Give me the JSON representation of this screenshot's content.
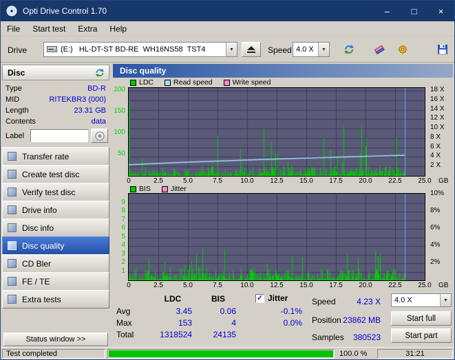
{
  "window": {
    "title": "Opti Drive Control 1.70"
  },
  "titlebar": {
    "minimize_glyph": "–",
    "maximize_glyph": "□",
    "close_glyph": "×"
  },
  "menu": {
    "items": [
      "File",
      "Start test",
      "Extra",
      "Help"
    ]
  },
  "toolbar": {
    "drive_label": "Drive",
    "drive_value": "(E:)   HL-DT-ST BD-RE  WH16NS58  TST4",
    "speed_label": "Speed",
    "speed_value": "4.0 X"
  },
  "sidebar": {
    "disc_header": "Disc",
    "info": [
      {
        "label": "Type",
        "value": "BD-R"
      },
      {
        "label": "MID",
        "value": "RITEKBR3 (000)"
      },
      {
        "label": "Length",
        "value": "23.31 GB"
      },
      {
        "label": "Contents",
        "value": "data"
      }
    ],
    "label_label": "Label",
    "label_value": "",
    "buttons": [
      "Transfer rate",
      "Create test disc",
      "Verify test disc",
      "Drive info",
      "Disc info",
      "Disc quality",
      "CD Bler",
      "FE / TE",
      "Extra tests"
    ],
    "selected": "Disc quality",
    "status_window": "Status window >>"
  },
  "panel": {
    "title": "Disc quality"
  },
  "chart_data": [
    {
      "type": "bar",
      "title": "Disc quality - LDC / Read speed",
      "plot_bg": "#5a5a78",
      "grid_color": "#3a3a58",
      "legend": [
        {
          "label": "LDC",
          "color": "#00c800"
        },
        {
          "label": "Read speed",
          "color": "#a8dcff"
        },
        {
          "label": "Write speed",
          "color": "#f48cc8"
        }
      ],
      "x_axis": {
        "range": [
          0,
          25
        ],
        "ticks": [
          "0",
          "2.5",
          "5.0",
          "7.5",
          "10.0",
          "12.5",
          "15.0",
          "17.5",
          "20.0",
          "22.5",
          "25.0"
        ],
        "unit": "GB"
      },
      "left_axis": {
        "range": [
          0,
          207
        ],
        "color": "#00d400",
        "ticks": [
          {
            "v": 200,
            "label": "200"
          },
          {
            "v": 150,
            "label": "150"
          },
          {
            "v": 100,
            "label": "100"
          },
          {
            "v": 50,
            "label": "50"
          }
        ]
      },
      "right_axis": {
        "range": [
          0,
          18.6
        ],
        "ticks": [
          {
            "v": 18,
            "label": "18 X"
          },
          {
            "v": 16,
            "label": "16 X"
          },
          {
            "v": 14,
            "label": "14 X"
          },
          {
            "v": 12,
            "label": "12 X"
          },
          {
            "v": 10,
            "label": "10 X"
          },
          {
            "v": 8,
            "label": "8 X"
          },
          {
            "v": 6,
            "label": "6 X"
          },
          {
            "v": 4,
            "label": "4 X"
          },
          {
            "v": 2,
            "label": "2 X"
          }
        ]
      },
      "h_grid": {
        "axis": "right",
        "values": [
          2,
          4,
          6,
          8,
          10,
          12,
          14,
          16,
          18
        ]
      },
      "series": [
        {
          "name": "LDC",
          "kind": "bars",
          "axis": "left",
          "color": "#00cc00",
          "seed": 1337,
          "base_min": 1.5,
          "base_max": 24,
          "spike_prob": 0.045,
          "spike_min": 25,
          "spike_max": 148,
          "first_value": 178,
          "end_x": 23.3,
          "stats": {
            "avg": 3.45,
            "max": 153,
            "total": 1318524
          }
        },
        {
          "name": "Read speed",
          "kind": "line",
          "axis": "right",
          "color": "#a8dcff",
          "x0": 0,
          "x1": 23.3,
          "v0": 2.35,
          "v1": 4.35,
          "stats": {
            "avg_speed_x": 4.23
          }
        }
      ],
      "end_line": {
        "x": 23.3,
        "color": "#58a8ff"
      }
    },
    {
      "type": "bar",
      "title": "Disc quality - BIS / Jitter",
      "plot_bg": "#5a5a78",
      "grid_color": "#3a3a58",
      "legend": [
        {
          "label": "BIS",
          "color": "#00c800"
        },
        {
          "label": "Jitter",
          "color": "#f48cc8"
        }
      ],
      "x_axis": {
        "range": [
          0,
          25
        ],
        "ticks": [
          "0",
          "2.5",
          "5.0",
          "7.5",
          "10.0",
          "12.5",
          "15.0",
          "17.5",
          "20.0",
          "22.5",
          "25.0"
        ],
        "unit": "GB"
      },
      "left_axis": {
        "range": [
          0,
          10.1
        ],
        "color": "#00d400",
        "ticks": [
          {
            "v": 9,
            "label": "9"
          },
          {
            "v": 8,
            "label": "8"
          },
          {
            "v": 7,
            "label": "7"
          },
          {
            "v": 6,
            "label": "6"
          },
          {
            "v": 5,
            "label": "5"
          },
          {
            "v": 4,
            "label": "4"
          },
          {
            "v": 3,
            "label": "3"
          },
          {
            "v": 2,
            "label": "2"
          },
          {
            "v": 1,
            "label": "1"
          }
        ]
      },
      "right_axis": {
        "range": [
          0,
          10.1
        ],
        "ticks": [
          {
            "v": 10,
            "label": "10%"
          },
          {
            "v": 8,
            "label": "8%"
          },
          {
            "v": 6,
            "label": "6%"
          },
          {
            "v": 4,
            "label": "4%"
          },
          {
            "v": 2,
            "label": "2%"
          }
        ]
      },
      "h_grid": {
        "axis": "left",
        "values": [
          1,
          2,
          3,
          4,
          5,
          6,
          7,
          8,
          9
        ]
      },
      "series": [
        {
          "name": "BIS",
          "kind": "bars",
          "axis": "left",
          "color": "#00cc00",
          "seed": 2024,
          "base_min": 0.05,
          "base_max": 1.45,
          "spike_prob": 0.05,
          "spike_min": 1.5,
          "spike_max": 3.9,
          "end_x": 23.3,
          "stats": {
            "avg": 0.06,
            "max": 4,
            "total": 24135
          }
        }
      ],
      "end_line": {
        "x": 23.3,
        "color": "#58a8ff"
      }
    }
  ],
  "results": {
    "col_headers": [
      "LDC",
      "BIS",
      "Jitter"
    ],
    "check_glyph": "✓",
    "rows": [
      {
        "label": "Avg",
        "values": [
          "3.45",
          "0.06",
          "-0.1%"
        ]
      },
      {
        "label": "Max",
        "values": [
          "153",
          "4",
          "0.0%"
        ]
      },
      {
        "label": "Total",
        "values": [
          "1318524",
          "24135",
          ""
        ]
      }
    ],
    "speed_label": "Speed",
    "speed_value": "4.23 X",
    "speed_select": "4.0 X",
    "position_label": "Position",
    "position_value": "23862 MB",
    "samples_label": "Samples",
    "samples_value": "380523",
    "start_full_label": "Start full",
    "start_part_label": "Start part"
  },
  "statusbar": {
    "status": "Test completed",
    "progress_percent": 100,
    "progress_text": "100.0 %",
    "time": "31:21"
  }
}
